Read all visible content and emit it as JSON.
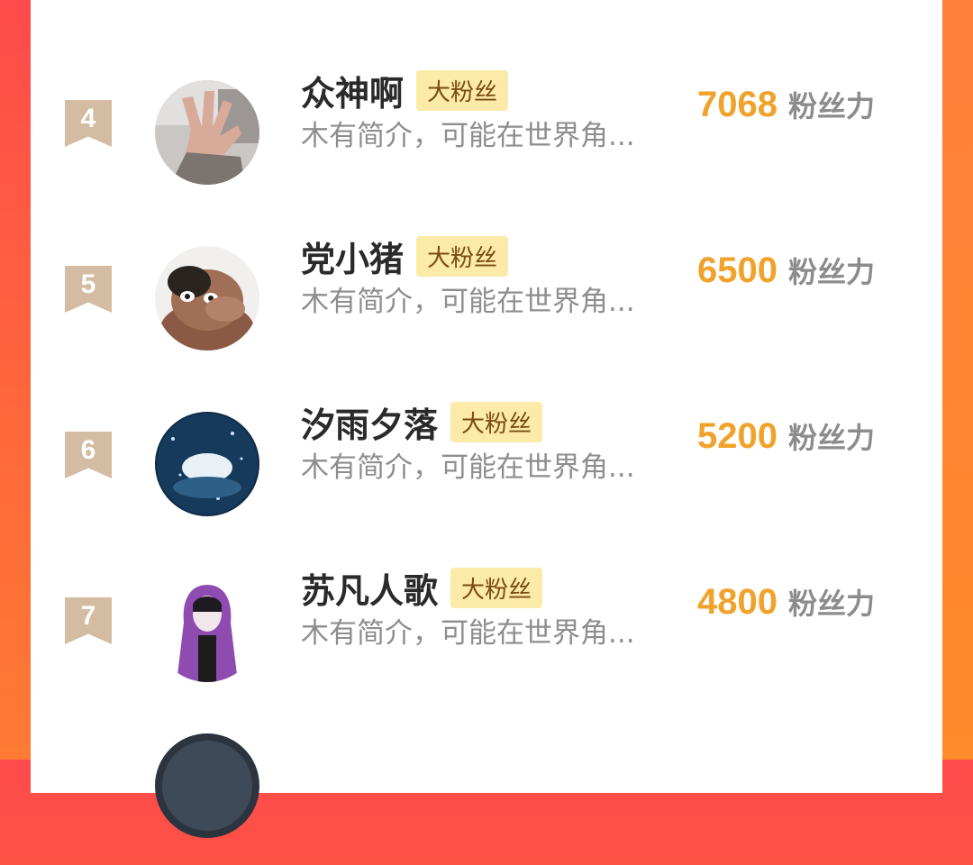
{
  "list": {
    "items": [
      {
        "rank": "4",
        "name": "众神啊",
        "tag": "大粉丝",
        "bio": "木有简介，可能在世界角...",
        "score": "7068",
        "unit": "粉丝力",
        "avatar": "hand-photo"
      },
      {
        "rank": "5",
        "name": "党小猪",
        "tag": "大粉丝",
        "bio": "木有简介，可能在世界角...",
        "score": "6500",
        "unit": "粉丝力",
        "avatar": "hippo-cartoon"
      },
      {
        "rank": "6",
        "name": "汐雨夕落",
        "tag": "大粉丝",
        "bio": "木有简介，可能在世界角...",
        "score": "5200",
        "unit": "粉丝力",
        "avatar": "night-whale-art"
      },
      {
        "rank": "7",
        "name": "苏凡人歌",
        "tag": "大粉丝",
        "bio": "木有简介，可能在世界角...",
        "score": "4800",
        "unit": "粉丝力",
        "avatar": "purple-hoodie-character"
      }
    ]
  },
  "colors": {
    "score": "#f0a22a",
    "tag_bg": "#fbeaa8",
    "rank_badge": "#d4bca2",
    "background_gradient_start": "#ff4b4b",
    "background_gradient_end": "#ff7a33"
  }
}
